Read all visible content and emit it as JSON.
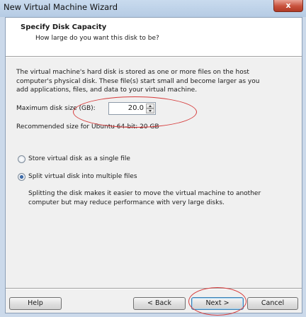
{
  "window": {
    "title": "New Virtual Machine Wizard",
    "close_glyph": "x"
  },
  "header": {
    "title": "Specify Disk Capacity",
    "subtitle": "How large do you want this disk to be?"
  },
  "description": {
    "lines": [
      "The virtual machine's hard disk is stored as one or more files on the host",
      "computer's physical disk. These file(s) start small and become larger as you",
      "add applications, files, and data to your virtual machine."
    ]
  },
  "disk_size": {
    "label": "Maximum disk size (GB):",
    "value": "20.0",
    "recommended": "Recommended size for Ubuntu 64-bit: 20 GB"
  },
  "options": {
    "single_file": {
      "label": "Store virtual disk as a single file",
      "selected": false
    },
    "multiple_files": {
      "label": "Split virtual disk into multiple files",
      "selected": true
    },
    "split_note": [
      "Splitting the disk makes it easier to move the virtual machine to another",
      "computer but may reduce performance with very large disks."
    ]
  },
  "buttons": {
    "help": "Help",
    "back": "< Back",
    "next": "Next >",
    "cancel": "Cancel"
  },
  "colors": {
    "annotation": "#d63b3b",
    "title_bar": "#c9dbee",
    "close_button": "#c8513c"
  }
}
